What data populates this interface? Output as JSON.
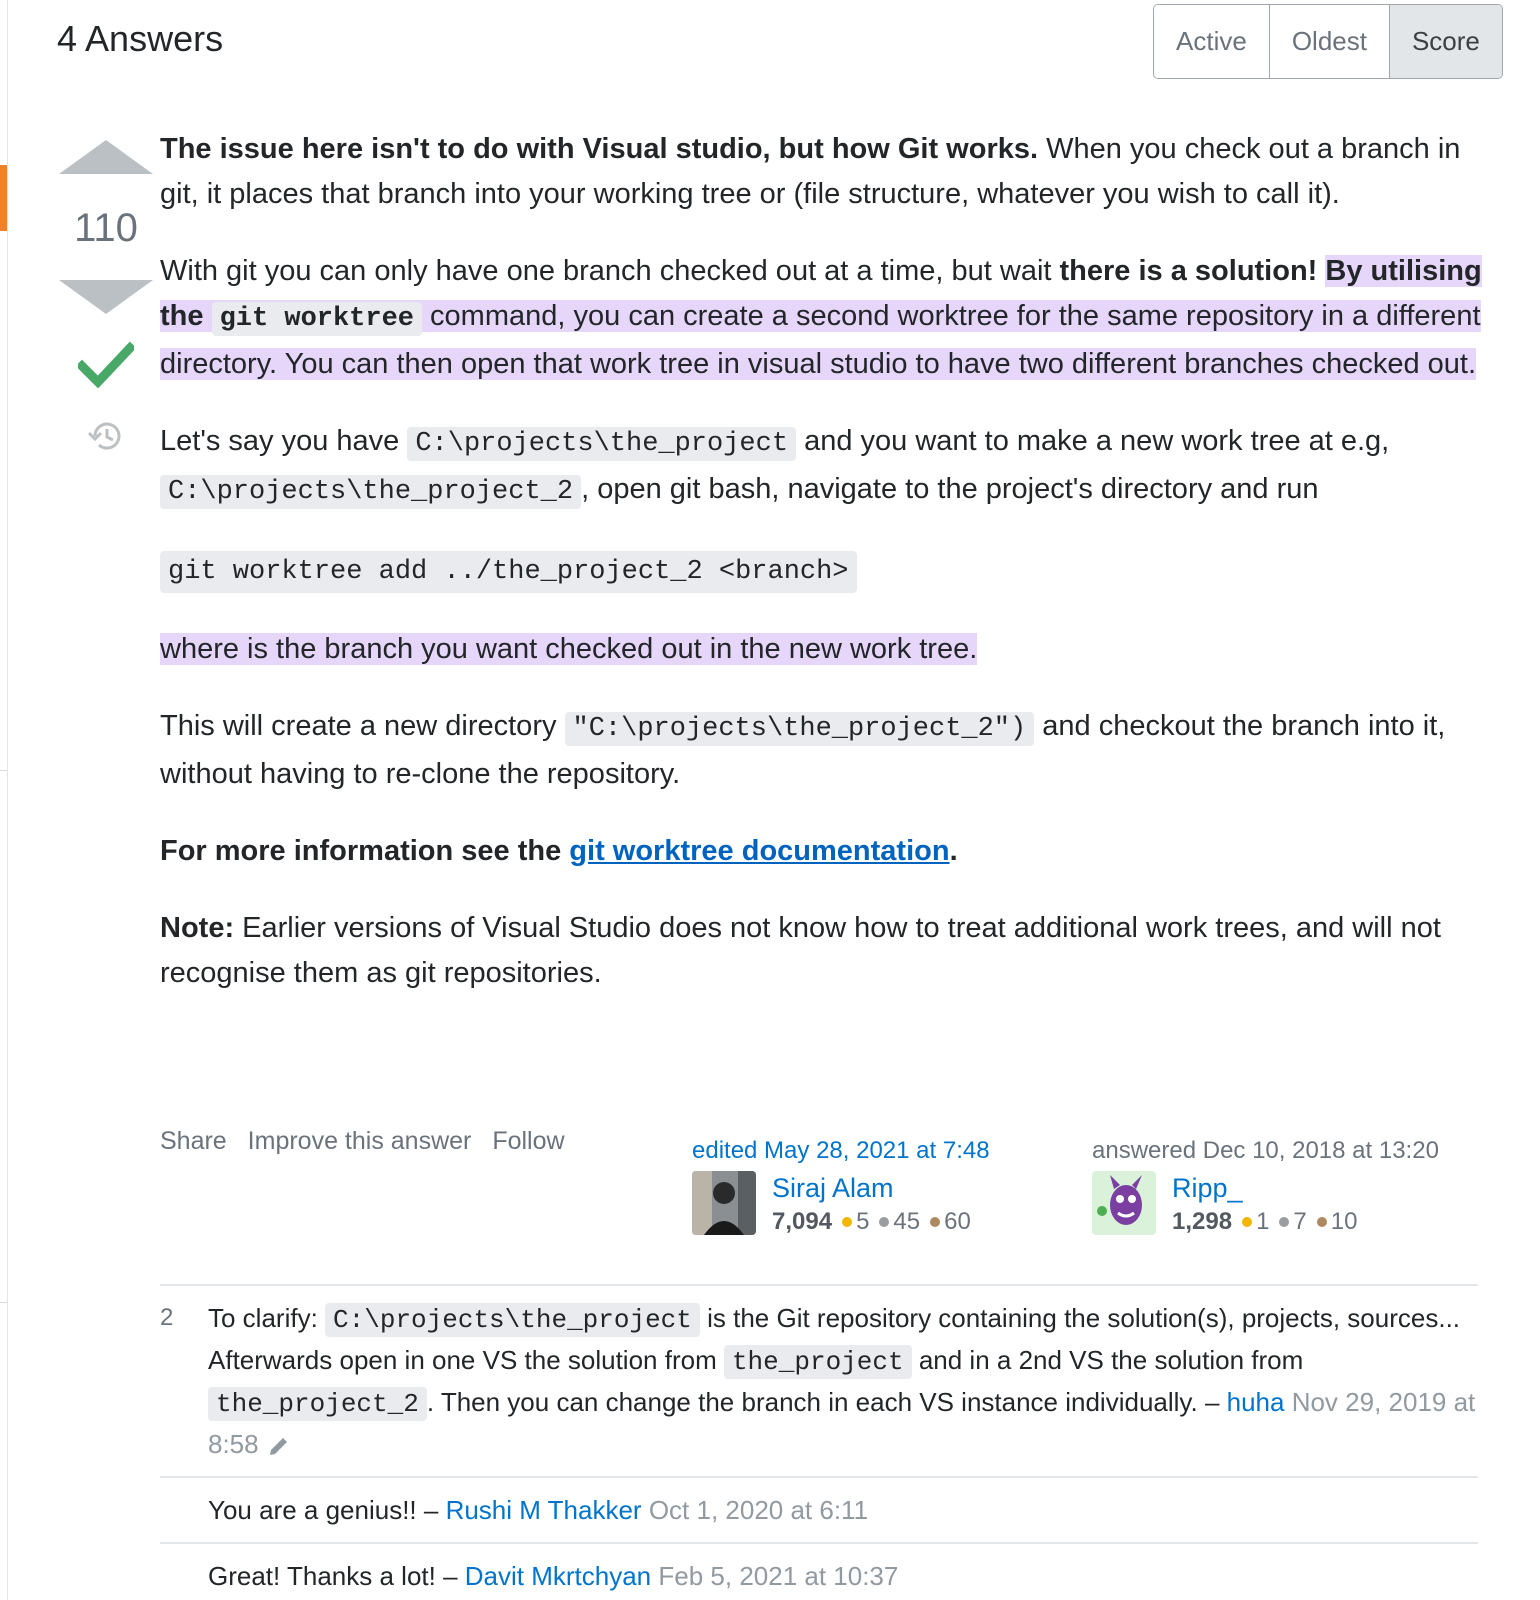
{
  "header": {
    "answers_count_label": "4 Answers",
    "sort_tabs": [
      {
        "label": "Active",
        "selected": false
      },
      {
        "label": "Oldest",
        "selected": false
      },
      {
        "label": "Score",
        "selected": true
      }
    ]
  },
  "votes": {
    "count": "110",
    "up_icon": "arrow-up-icon",
    "down_icon": "arrow-down-icon",
    "accepted_icon": "checkmark-icon",
    "history_icon": "history-icon"
  },
  "answer": {
    "p1_bold": "The issue here isn't to do with Visual studio, but how Git works.",
    "p1_rest": " When you check out a branch in git, it places that branch into your working tree or (file structure, whatever you wish to call it).",
    "p2_a": "With git you can only have one branch checked out at a time, but wait ",
    "p2_bold": "there is a solution!",
    "p2_space": " ",
    "p2_hl_bold": "By utilising the ",
    "p2_code": "git worktree",
    "p2_hl_rest": " command, you can create a second worktree for the same repository in a different directory. You can then open that work tree in visual studio to have two different branches checked out.",
    "p3_a": "Let's say you have ",
    "p3_code1": "C:\\projects\\the_project",
    "p3_b": " and you want to make a new work tree at e.g, ",
    "p3_code2": "C:\\projects\\the_project_2",
    "p3_c": ", open git bash, navigate to the project's directory and run",
    "pre_code": "git worktree add ../the_project_2 <branch>",
    "p4": "where is the branch you want checked out in the new work tree.",
    "p5_a": "This will create a new directory ",
    "p5_code": "\"C:\\projects\\the_project_2\")",
    "p5_b": " and checkout the branch into it, without having to re-clone the repository.",
    "p6_bold": "For more information see the ",
    "p6_link": "git worktree documentation",
    "p6_end": ".",
    "p7_bold": "Note:",
    "p7_rest": " Earlier versions of Visual Studio does not know how to treat additional work trees, and will not recognise them as git repositories."
  },
  "post_menu": {
    "share": "Share",
    "improve": "Improve this answer",
    "follow": "Follow"
  },
  "editor": {
    "action": "edited May 28, 2021 at 7:48",
    "name": "Siraj Alam",
    "rep": "7,094",
    "gold": "5",
    "silver": "45",
    "bronze": "60"
  },
  "author": {
    "action": "answered Dec 10, 2018 at 13:20",
    "name": "Ripp_",
    "rep": "1,298",
    "gold": "1",
    "silver": "7",
    "bronze": "10"
  },
  "comments": [
    {
      "score": "2",
      "a": "To clarify: ",
      "code1": "C:\\projects\\the_project",
      "b": " is the Git repository containing the solution(s), projects, sources... Afterwards open in one VS the solution from ",
      "code2": "the_project",
      "c": " and in a 2nd VS the solution from ",
      "code3": "the_project_2",
      "d": ". Then you can change the branch in each VS instance individually. – ",
      "user": "huha",
      "date": " Nov 29, 2019 at 8:58"
    },
    {
      "score": "",
      "text": "You are a genius!! – ",
      "user": "Rushi M Thakker",
      "date": " Oct 1, 2020 at 6:11"
    },
    {
      "score": "",
      "text": "Great! Thanks a lot! – ",
      "user": "Davit Mkrtchyan",
      "date": " Feb 5, 2021 at 10:37"
    }
  ]
}
